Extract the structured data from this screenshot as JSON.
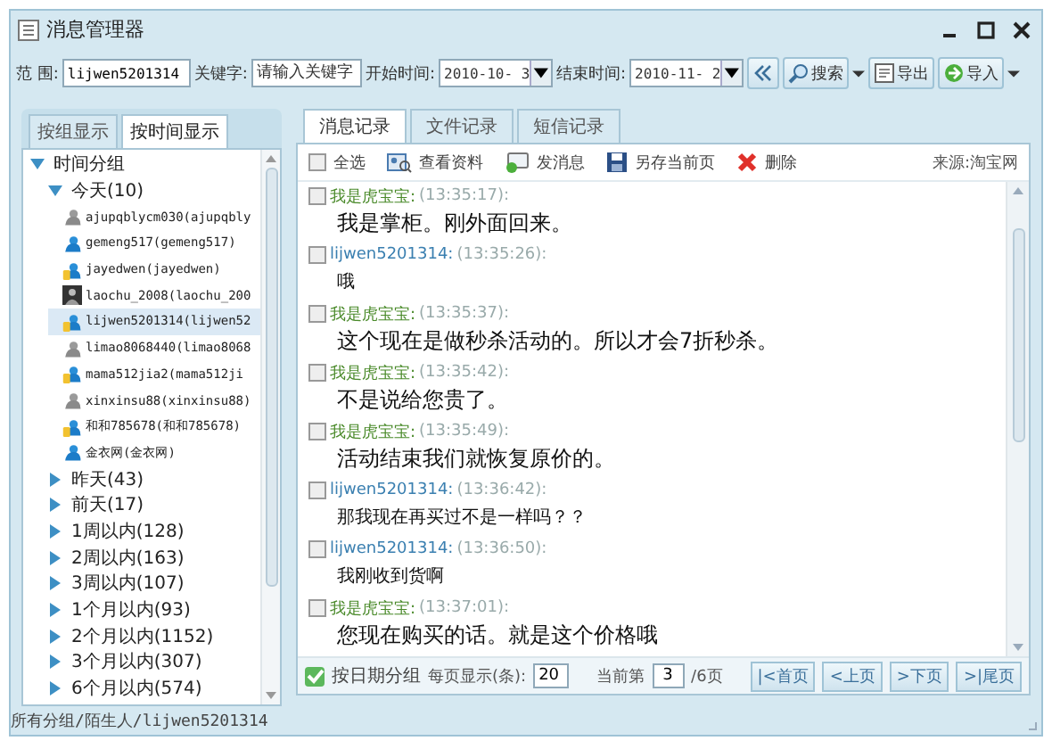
{
  "window": {
    "title": "消息管理器"
  },
  "toolbar": {
    "range_label": "范 围:",
    "range_value": "lijwen5201314",
    "keyword_label": "关键字:",
    "keyword_placeholder": "请输入关键字",
    "start_label": "开始时间:",
    "start_value": "2010-10- 3",
    "end_label": "结束时间:",
    "end_value": "2010-11- 2",
    "buttons": [
      {
        "label": "搜索",
        "kind": "search"
      },
      {
        "label": "导出",
        "kind": "export"
      },
      {
        "label": "导入",
        "kind": "import"
      }
    ]
  },
  "left_tabs": [
    {
      "label": "按组显示",
      "selected": false
    },
    {
      "label": "按时间显示",
      "selected": true
    }
  ],
  "tree": [
    {
      "label": "时间分组",
      "expanded": true,
      "children": [
        {
          "label": "今天(10)",
          "expanded": true,
          "children": [
            {
              "label": "ajupqblycm030(ajupqbly",
              "kind": "offline",
              "selected": false
            },
            {
              "label": "gemeng517(gemeng517)",
              "kind": "online",
              "selected": false
            },
            {
              "label": "jayedwen(jayedwen)",
              "kind": "mobile",
              "selected": false
            },
            {
              "label": "laochu_2008(laochu_200",
              "kind": "photo",
              "selected": false
            },
            {
              "label": "lijwen5201314(lijwen52",
              "kind": "mobile",
              "selected": true
            },
            {
              "label": "limao8068440(limao8068",
              "kind": "offline",
              "selected": false
            },
            {
              "label": "mama512jia2(mama512ji",
              "kind": "mobile",
              "selected": false
            },
            {
              "label": "xinxinsu88(xinxinsu88)",
              "kind": "offline",
              "selected": false
            },
            {
              "label": "和和785678(和和785678)",
              "kind": "mobile",
              "selected": false
            },
            {
              "label": "金衣网(金衣网)",
              "kind": "online",
              "selected": false
            }
          ]
        },
        {
          "label": "昨天(43)",
          "expanded": false
        },
        {
          "label": "前天(17)",
          "expanded": false
        },
        {
          "label": "1周以内(128)",
          "expanded": false
        },
        {
          "label": "2周以内(163)",
          "expanded": false
        },
        {
          "label": "3周以内(107)",
          "expanded": false
        },
        {
          "label": "1个月以内(93)",
          "expanded": false
        },
        {
          "label": "2个月以内(1152)",
          "expanded": false
        },
        {
          "label": "3个月以内(307)",
          "expanded": false
        },
        {
          "label": "6个月以内(574)",
          "expanded": false
        }
      ]
    }
  ],
  "right_tabs": [
    {
      "label": "消息记录",
      "selected": true
    },
    {
      "label": "文件记录",
      "selected": false
    },
    {
      "label": "短信记录",
      "selected": false
    }
  ],
  "actions": {
    "select_all": {
      "label": "全选",
      "checked": false
    },
    "buttons": [
      {
        "label": "查看资料",
        "kind": "profile"
      },
      {
        "label": "发消息",
        "kind": "message"
      },
      {
        "label": "另存当前页",
        "kind": "save"
      },
      {
        "label": "删除",
        "kind": "delete"
      }
    ],
    "source": "来源:淘宝网"
  },
  "messages": [
    {
      "sender": "我是虎宝宝:",
      "time": "(13:35:17):",
      "text": "我是掌柜。刚外面回来。",
      "kind": "seller",
      "checked": false
    },
    {
      "sender": "lijwen5201314:",
      "time": "(13:35:26):",
      "text": "哦",
      "kind": "buyer",
      "checked": false
    },
    {
      "sender": "我是虎宝宝:",
      "time": "(13:35:37):",
      "text": "这个现在是做秒杀活动的。所以才会7折秒杀。",
      "kind": "seller",
      "checked": false
    },
    {
      "sender": "我是虎宝宝:",
      "time": "(13:35:42):",
      "text": "不是说给您贵了。",
      "kind": "seller",
      "checked": false
    },
    {
      "sender": "我是虎宝宝:",
      "time": "(13:35:49):",
      "text": "活动结束我们就恢复原价的。",
      "kind": "seller",
      "checked": false
    },
    {
      "sender": "lijwen5201314:",
      "time": "(13:36:42):",
      "text": "那我现在再买过不是一样吗？？",
      "kind": "buyer",
      "checked": false
    },
    {
      "sender": "lijwen5201314:",
      "time": "(13:36:50):",
      "text": "我刚收到货啊",
      "kind": "buyer",
      "checked": false
    },
    {
      "sender": "我是虎宝宝:",
      "time": "(13:37:01):",
      "text": "您现在购买的话。就是这个价格哦",
      "kind": "seller",
      "checked": false
    }
  ],
  "footer": {
    "group_by_date": {
      "label": "按日期分组",
      "checked": true
    },
    "per_page_label": "每页显示(条):",
    "per_page": "20",
    "current_label": "当前第",
    "current": "3",
    "total": "/6页",
    "pager": [
      "|<首页",
      "<上页",
      ">下页",
      ">|尾页"
    ]
  },
  "status_bar": "所有分组/陌生人/lijwen5201314"
}
